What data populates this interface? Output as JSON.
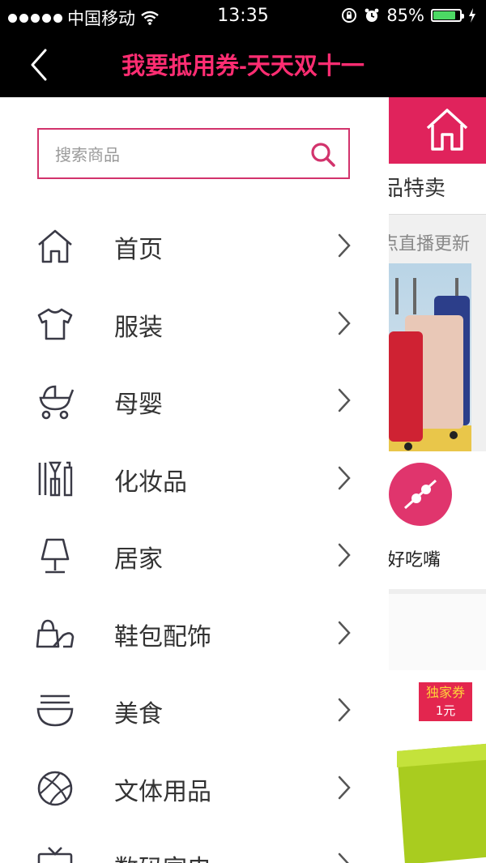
{
  "status_bar": {
    "carrier": "中国移动",
    "time": "13:35",
    "battery": "85%",
    "battery_level": 0.85
  },
  "nav": {
    "title": "我要抵用券-天天双十一"
  },
  "search": {
    "placeholder": "搜索商品"
  },
  "menu": {
    "items": [
      {
        "label": "首页",
        "icon": "home-icon"
      },
      {
        "label": "服装",
        "icon": "tshirt-icon"
      },
      {
        "label": "母婴",
        "icon": "stroller-icon"
      },
      {
        "label": "化妆品",
        "icon": "cosmetics-icon"
      },
      {
        "label": "居家",
        "icon": "lamp-icon"
      },
      {
        "label": "鞋包配饰",
        "icon": "shoe-bag-icon"
      },
      {
        "label": "美食",
        "icon": "noodle-bowl-icon"
      },
      {
        "label": "文体用品",
        "icon": "ball-icon"
      },
      {
        "label": "数码家电",
        "icon": "tv-icon"
      }
    ]
  },
  "background_page": {
    "tab_label": "品特卖",
    "live_label": "点直播更新",
    "snack_label": "好吃嘴",
    "badge_title": "独家券",
    "badge_value": "1元"
  },
  "colors": {
    "accent": "#e0235c",
    "title": "#ff2d72",
    "search_border": "#d2336c"
  }
}
